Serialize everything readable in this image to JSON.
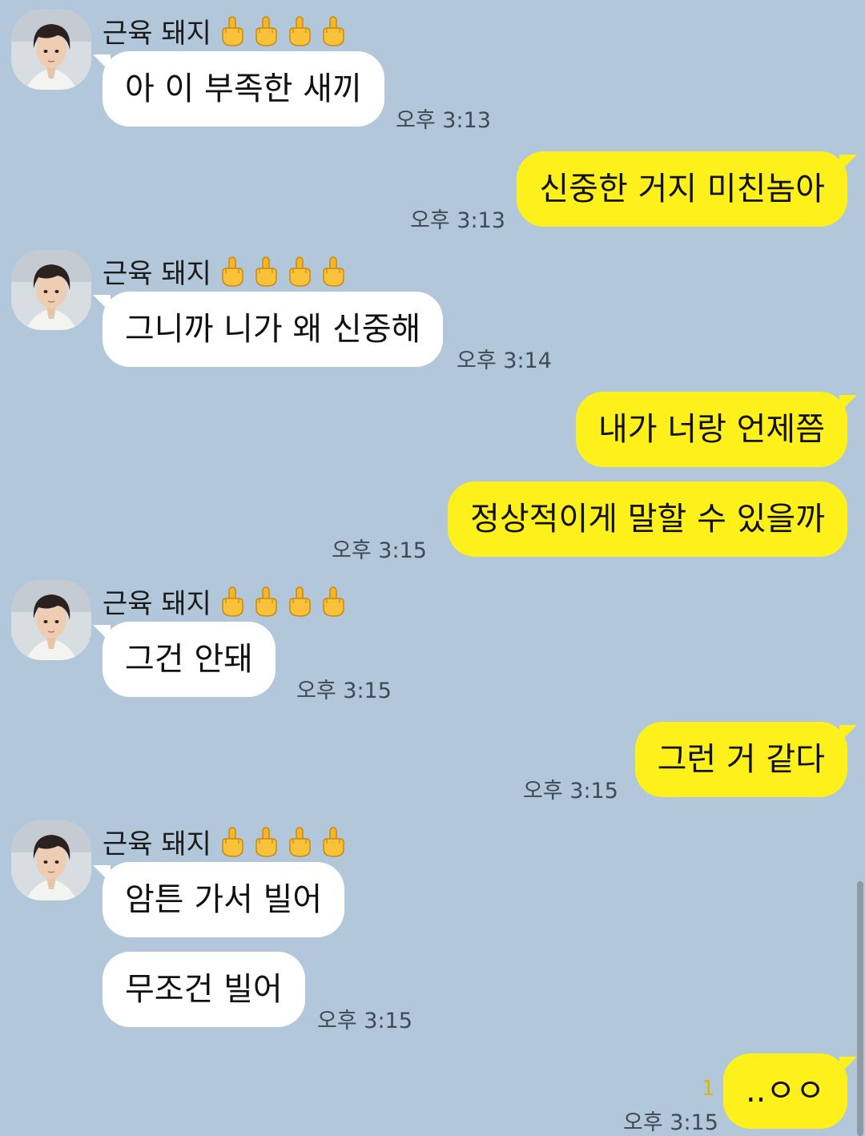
{
  "sender": {
    "name": "근육 돼지",
    "avatar_icon": "profile-photo",
    "name_icons": [
      "middle-finger-emoji",
      "middle-finger-emoji",
      "middle-finger-emoji",
      "middle-finger-emoji"
    ]
  },
  "messages": [
    {
      "text": "아 이 부족한 새끼",
      "time": "오후 3:13"
    },
    {
      "text": "신중한 거지 미친놈아",
      "time": "오후 3:13"
    },
    {
      "text": "그니까 니가 왜 신중해",
      "time": "오후 3:14"
    },
    {
      "text": "내가 너랑 언제쯤",
      "time": ""
    },
    {
      "text": "정상적이게 말할 수 있을까",
      "time": "오후 3:15"
    },
    {
      "text": "그건 안돼",
      "time": "오후 3:15"
    },
    {
      "text": "그런 거 같다",
      "time": "오후 3:15"
    },
    {
      "text": "암튼 가서 빌어",
      "time": ""
    },
    {
      "text": "무조건 빌어",
      "time": "오후 3:15"
    },
    {
      "text": "..ㅇㅇ",
      "time": "오후 3:15",
      "unread": "1"
    }
  ],
  "colors": {
    "background": "#b2c7da",
    "incoming": "#ffffff",
    "outgoing": "#fef01b",
    "unread": "#d9b800"
  }
}
